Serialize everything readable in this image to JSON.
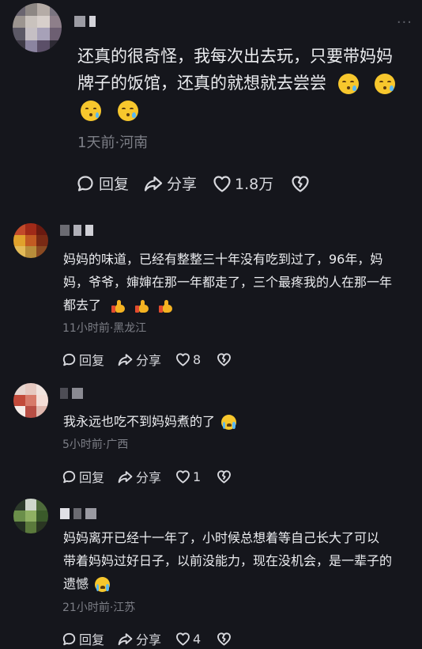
{
  "more_label": "···",
  "comments": [
    {
      "text_lines": [
        "还真的很奇怪，我每次出去玩，只要带妈妈",
        "牌子的饭馆，还真的就想就去尝尝",
        ""
      ],
      "time": "1天前",
      "location": "河南",
      "reply_label": "回复",
      "share_label": "分享",
      "like_count": "1.8万"
    },
    {
      "text_lines": [
        "妈妈的味道，已经有整整三十年没有吃到过了，96年，妈",
        "妈，爷爷，婶婶在那一年都走了，三个最疼我的人在那一年",
        "都去了"
      ],
      "time": "11小时前",
      "location": "黑龙江",
      "reply_label": "回复",
      "share_label": "分享",
      "like_count": "8"
    },
    {
      "text_lines": [
        "我永远也吃不到妈妈煮的了"
      ],
      "time": "5小时前",
      "location": "广西",
      "reply_label": "回复",
      "share_label": "分享",
      "like_count": "1"
    },
    {
      "text_lines": [
        "妈妈离开已经十一年了，小时候总想着等自己长大了可以",
        "带着妈妈过好日子，以前没能力，现在没机会，是一辈子的",
        "遗憾"
      ],
      "time": "21小时前",
      "location": "江苏",
      "reply_label": "回复",
      "share_label": "分享",
      "like_count": "4"
    }
  ],
  "colors": {
    "background": "#15161c",
    "text": "#ecedf0",
    "meta": "#7d7f87"
  },
  "icons": [
    "more-icon",
    "reply-bubble-icon",
    "share-arrow-icon",
    "like-heart-icon",
    "dislike-broken-heart-icon",
    "dizzy-face-emoji",
    "thumbs-up-emoji",
    "crying-face-emoji"
  ]
}
